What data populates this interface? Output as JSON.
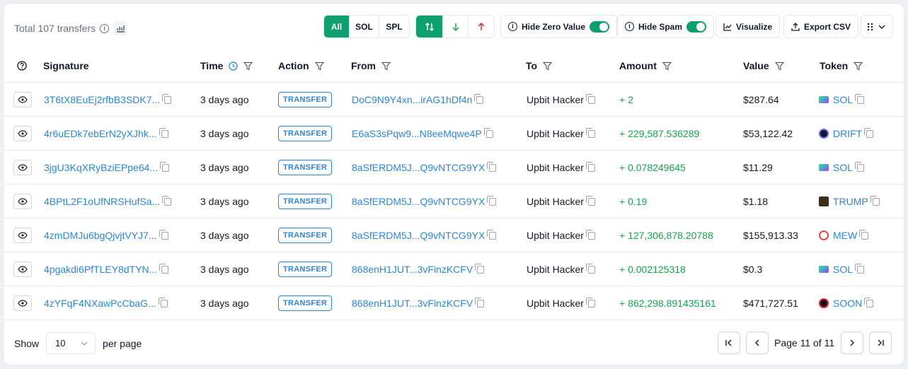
{
  "toolbar": {
    "total_label": "Total 107 transfers",
    "filter_all": "All",
    "filter_sol": "SOL",
    "filter_spl": "SPL",
    "hide_zero_label": "Hide Zero Value",
    "hide_spam_label": "Hide Spam",
    "visualize_label": "Visualize",
    "export_label": "Export CSV"
  },
  "columns": {
    "signature": "Signature",
    "time": "Time",
    "action": "Action",
    "from": "From",
    "to": "To",
    "amount": "Amount",
    "value": "Value",
    "token": "Token"
  },
  "rows": [
    {
      "signature": "3T6tX8EuEj2rfbB3SDK7...",
      "time": "3 days ago",
      "action": "TRANSFER",
      "from": "DoC9N9Y4xn...irAG1hDf4n",
      "to": "Upbit Hacker",
      "amount": "+ 2",
      "value": "$287.64",
      "token": "SOL"
    },
    {
      "signature": "4r6uEDk7ebErN2yXJhk...",
      "time": "3 days ago",
      "action": "TRANSFER",
      "from": "E6aS3sPqw9...N8eeMqwe4P",
      "to": "Upbit Hacker",
      "amount": "+ 229,587.536289",
      "value": "$53,122.42",
      "token": "DRIFT"
    },
    {
      "signature": "3jgU3KqXRyBziEPpe64...",
      "time": "3 days ago",
      "action": "TRANSFER",
      "from": "8aSfERDM5J...Q9vNTCG9YX",
      "to": "Upbit Hacker",
      "amount": "+ 0.078249645",
      "value": "$11.29",
      "token": "SOL"
    },
    {
      "signature": "4BPtL2F1oUfNRSHufSa...",
      "time": "3 days ago",
      "action": "TRANSFER",
      "from": "8aSfERDM5J...Q9vNTCG9YX",
      "to": "Upbit Hacker",
      "amount": "+ 0.19",
      "value": "$1.18",
      "token": "TRUMP"
    },
    {
      "signature": "4zmDMJu6bgQjvjtVYJ7...",
      "time": "3 days ago",
      "action": "TRANSFER",
      "from": "8aSfERDM5J...Q9vNTCG9YX",
      "to": "Upbit Hacker",
      "amount": "+ 127,306,878.20788",
      "value": "$155,913.33",
      "token": "MEW"
    },
    {
      "signature": "4pgakdi6PfTLEY8dTYN...",
      "time": "3 days ago",
      "action": "TRANSFER",
      "from": "868enH1JUT...3vFinzKCFV",
      "to": "Upbit Hacker",
      "amount": "+ 0.002125318",
      "value": "$0.3",
      "token": "SOL"
    },
    {
      "signature": "4zYFqF4NXawPcCbaG...",
      "time": "3 days ago",
      "action": "TRANSFER",
      "from": "868enH1JUT...3vFinzKCFV",
      "to": "Upbit Hacker",
      "amount": "+ 862,298.891435161",
      "value": "$471,727.51",
      "token": "SOON"
    }
  ],
  "footer": {
    "show_label": "Show",
    "per_page_value": "10",
    "per_page_label": "per page",
    "page_text": "Page 11 of 11"
  },
  "colors": {
    "accent": "#0e9f6e",
    "link": "#2c86d6",
    "amount": "#16a34a"
  }
}
